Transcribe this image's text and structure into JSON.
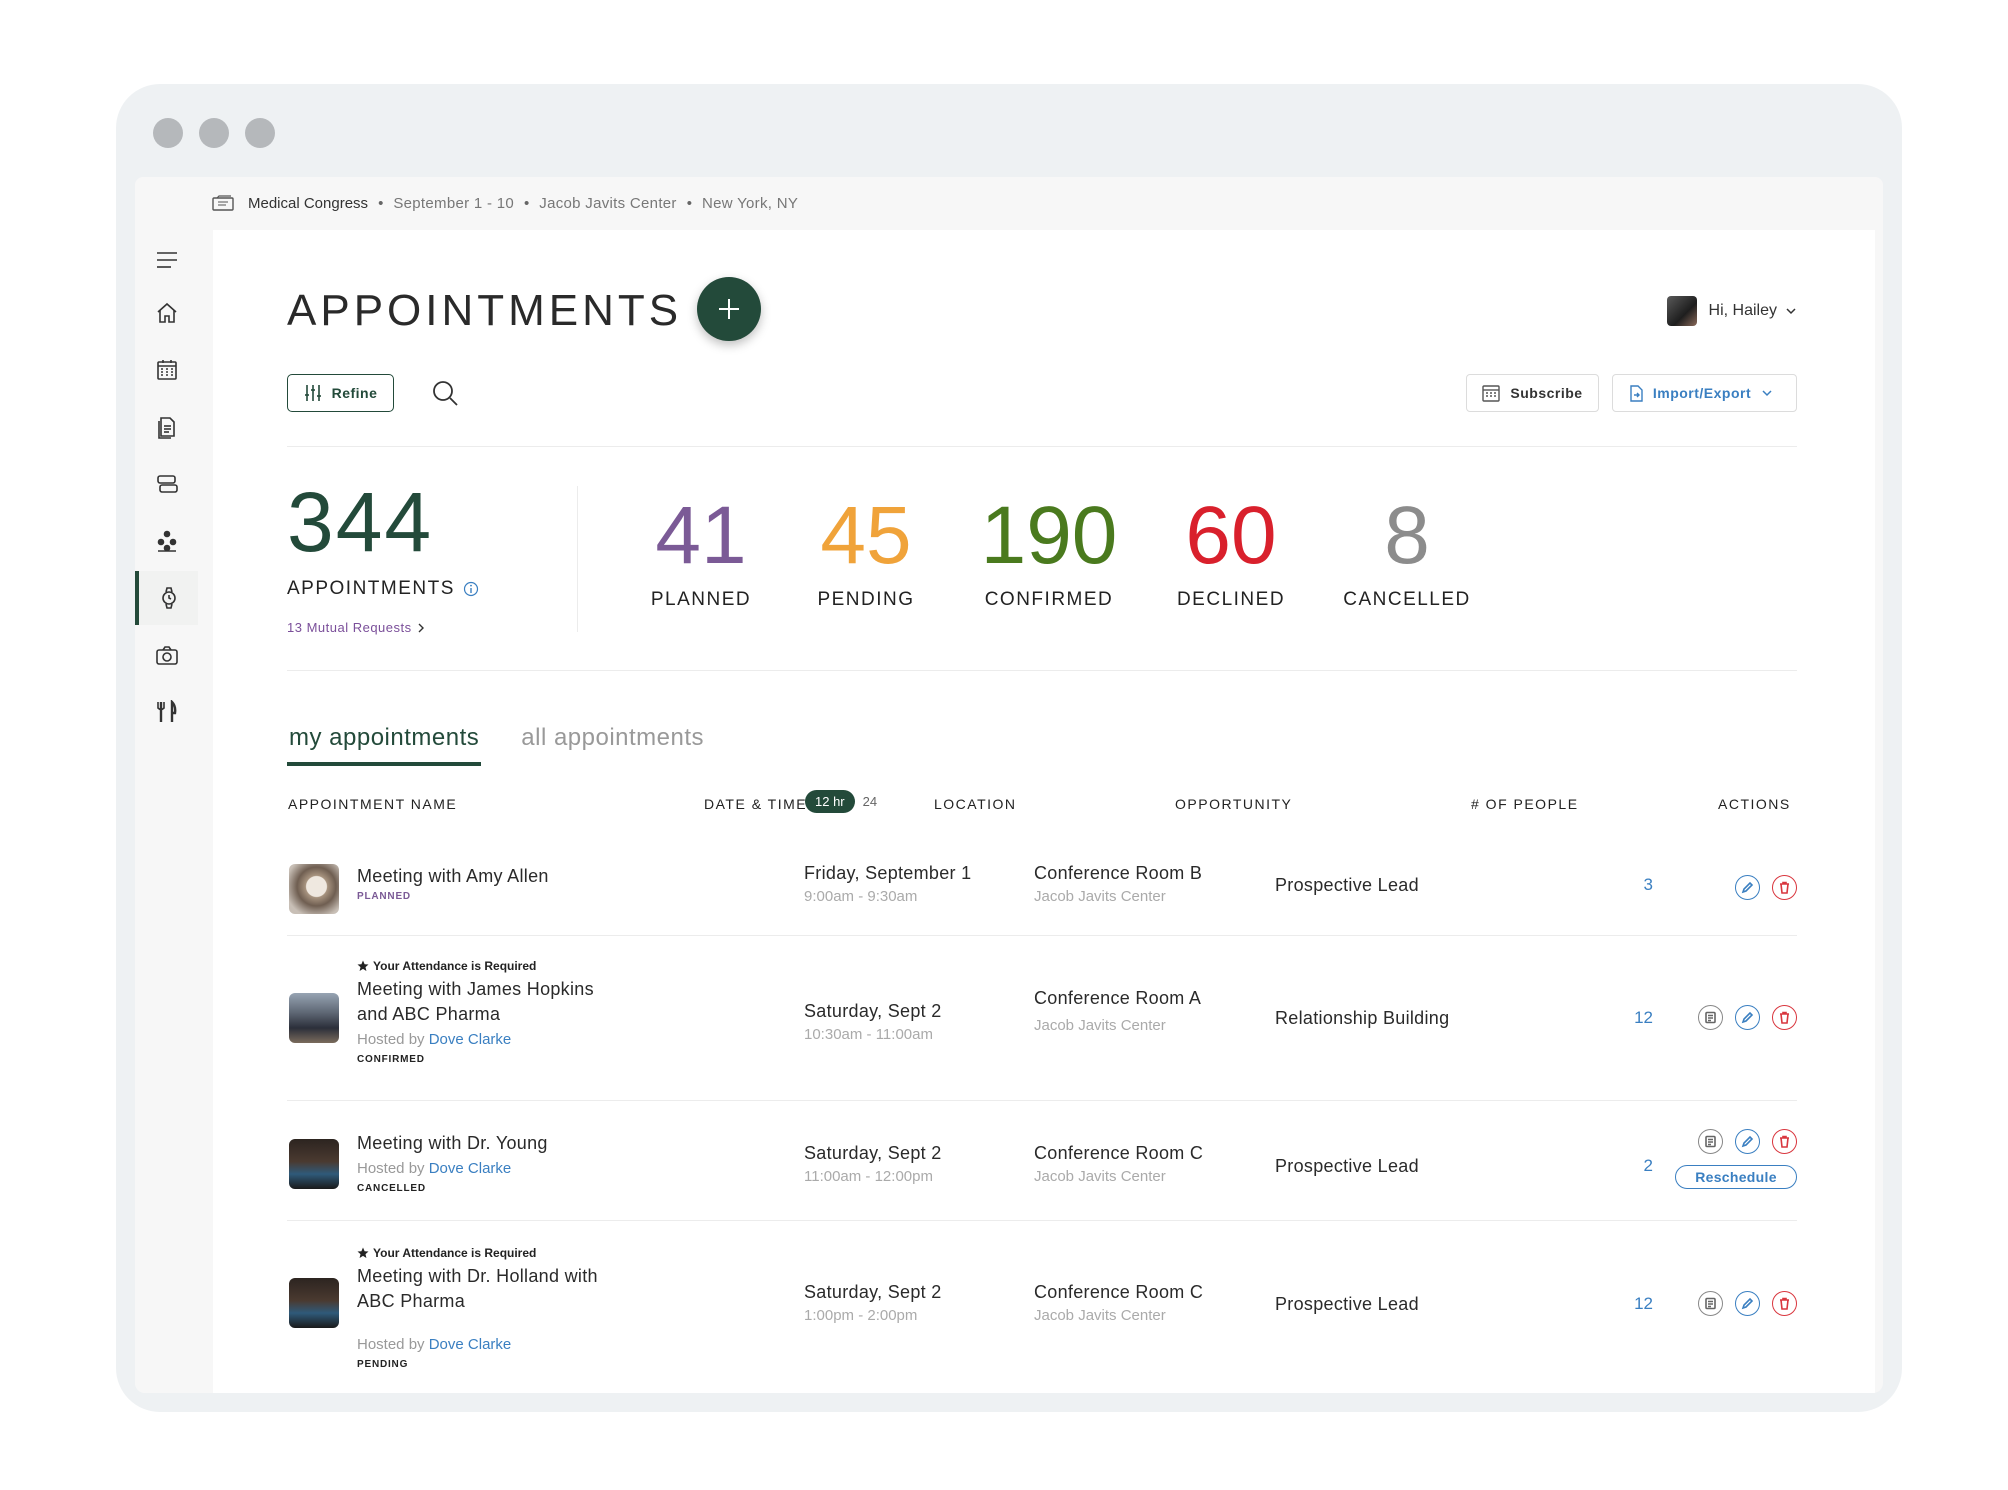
{
  "header": {
    "event_name": "Medical Congress",
    "dates": "September 1 - 10",
    "venue": "Jacob Javits Center",
    "city": "New York, NY",
    "separator": "•"
  },
  "sidebar": {
    "items": [
      {
        "icon": "menu-icon",
        "active": false
      },
      {
        "icon": "home-icon",
        "active": false
      },
      {
        "icon": "calendar-icon",
        "active": false
      },
      {
        "icon": "document-icon",
        "active": false
      },
      {
        "icon": "list-icon",
        "active": false
      },
      {
        "icon": "network-icon",
        "active": false
      },
      {
        "icon": "watch-icon",
        "active": true
      },
      {
        "icon": "camera-icon",
        "active": false
      },
      {
        "icon": "dining-icon",
        "active": false
      }
    ]
  },
  "page": {
    "title": "APPOINTMENTS",
    "user_greeting": "Hi, Hailey"
  },
  "toolbar": {
    "refine_label": "Refine",
    "subscribe_label": "Subscribe",
    "import_export_label": "Import/Export"
  },
  "stats": {
    "total_value": "344",
    "total_label": "APPOINTMENTS",
    "mutual_requests": "13 Mutual Requests",
    "items": [
      {
        "value": "41",
        "label": "PLANNED",
        "color": "#7b5a96"
      },
      {
        "value": "45",
        "label": "PENDING",
        "color": "#f0a33a"
      },
      {
        "value": "190",
        "label": "CONFIRMED",
        "color": "#4a7a1e"
      },
      {
        "value": "60",
        "label": "DECLINED",
        "color": "#d9202c"
      },
      {
        "value": "8",
        "label": "CANCELLED",
        "color": "#8c8c8c"
      }
    ],
    "total_color": "#234a3a"
  },
  "tabs": [
    {
      "label": "my appointments",
      "active": true
    },
    {
      "label": "all appointments",
      "active": false
    }
  ],
  "table": {
    "headers": {
      "name": "APPOINTMENT NAME",
      "datetime": "DATE & TIME",
      "location": "LOCATION",
      "opportunity": "OPPORTUNITY",
      "people": "# OF PEOPLE",
      "actions": "ACTIONS"
    },
    "time_format_on": "12 hr",
    "time_format_off": "24",
    "rows": [
      {
        "required": "",
        "name_line1": "Meeting with Amy Allen",
        "name_line2": "",
        "hosted_prefix": "",
        "host": "",
        "status": "PLANNED",
        "status_color": "#7b5a96",
        "date": "Friday, September 1",
        "time": "9:00am - 9:30am",
        "room": "Conference Room B",
        "venue": "Jacob Javits Center",
        "opportunity": "Prospective Lead",
        "people": "3",
        "thumb": "coffee"
      },
      {
        "required": "Your Attendance is Required",
        "name_line1": "Meeting with James Hopkins",
        "name_line2": "and ABC Pharma",
        "hosted_prefix": "Hosted by ",
        "host": "Dove Clarke",
        "status": "CONFIRMED",
        "status_color": "#222222",
        "date": "Saturday, Sept 2",
        "time": "10:30am - 11:00am",
        "room": "Conference Room A",
        "venue": "Jacob Javits Center",
        "opportunity": "Relationship Building",
        "people": "12",
        "thumb": "street"
      },
      {
        "required": "",
        "name_line1": "Meeting with Dr. Young",
        "name_line2": "",
        "hosted_prefix": "Hosted by ",
        "host": "Dove Clarke",
        "status": "CANCELLED",
        "status_color": "#222222",
        "date": "Saturday, Sept 2",
        "time": "11:00am - 12:00pm",
        "room": "Conference Room C",
        "venue": "Jacob Javits Center",
        "opportunity": "Prospective Lead",
        "people": "2",
        "thumb": "cafe",
        "reschedule_label": "Reschedule"
      },
      {
        "required": "Your Attendance is Required",
        "name_line1": "Meeting with Dr. Holland with",
        "name_line2": "ABC Pharma",
        "hosted_prefix": "Hosted by ",
        "host": "Dove Clarke",
        "status": "PENDING",
        "status_color": "#222222",
        "date": "Saturday, Sept 2",
        "time": "1:00pm - 2:00pm",
        "room": "Conference Room C",
        "venue": "Jacob Javits Center",
        "opportunity": "Prospective Lead",
        "people": "12",
        "thumb": "cafe"
      }
    ]
  }
}
